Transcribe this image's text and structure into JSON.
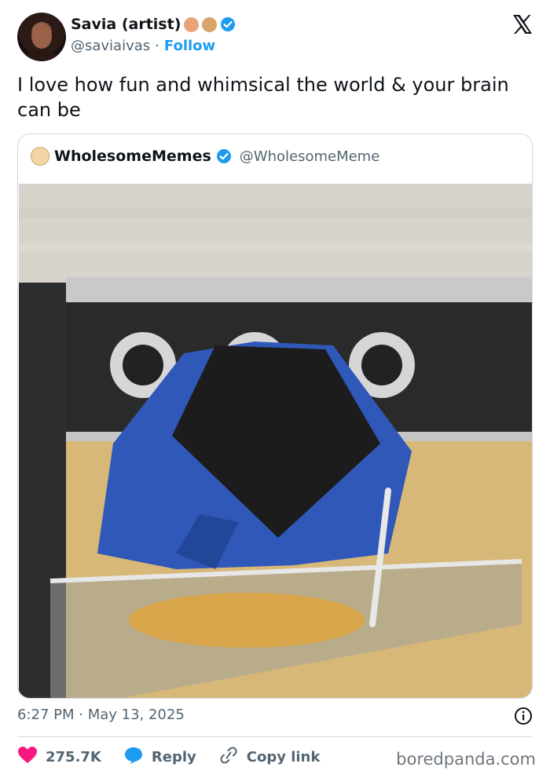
{
  "author": {
    "display_name": "Savia (artist)",
    "handle": "@saviaivas",
    "separator": "·",
    "follow_label": "Follow",
    "badges": [
      "artist-emoji",
      "palette-emoji",
      "verified-icon"
    ]
  },
  "tweet": {
    "text": "I love how fun and whimsical the world & your brain can be"
  },
  "quote": {
    "display_name": "WholesomeMemes",
    "handle": "@WholesomeMeme",
    "image_description_icon": "photo of an open blue chip bag in front of an oven knob panel resembling a face"
  },
  "meta": {
    "timestamp": "6:27 PM · May 13, 2025"
  },
  "actions": {
    "likes": "275.7K",
    "reply_label": "Reply",
    "copy_label": "Copy link"
  },
  "watermark": "boredpanda.com",
  "colors": {
    "accent": "#1d9bf0",
    "heart": "#f91880",
    "text": "#0f1419",
    "muted": "#536471"
  }
}
